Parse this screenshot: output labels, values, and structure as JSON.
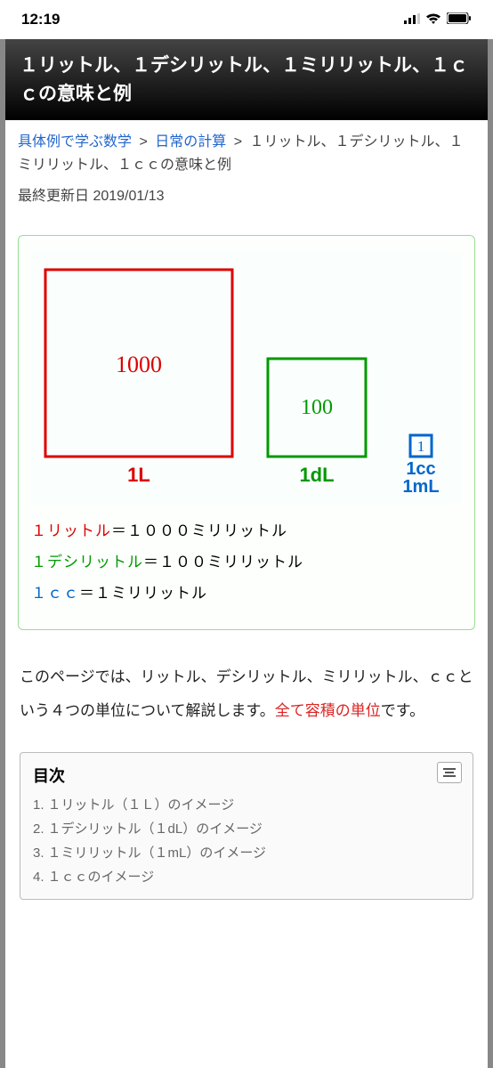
{
  "statusBar": {
    "time": "12:19"
  },
  "pageTitle": "１リットル、１デシリットル、１ミリリットル、１ｃｃの意味と例",
  "breadcrumb": {
    "link1": "具体例で学ぶ数学",
    "link2": "日常の計算",
    "current": "１リットル、１デシリットル、１ミリリットル、１ｃｃの意味と例",
    "sep": ">"
  },
  "lastUpdated": "最終更新日 2019/01/13",
  "diagram": {
    "liter": {
      "value": "1000",
      "label": "1L",
      "color": "#d00"
    },
    "deciliter": {
      "value": "100",
      "label": "1dL",
      "color": "#090"
    },
    "cc": {
      "value": "1",
      "label1": "1cc",
      "label2": "1mL",
      "color": "#06c"
    }
  },
  "conversions": {
    "liter": {
      "key": "１リットル",
      "rest": "＝１０００ミリリットル"
    },
    "deciliter": {
      "key": "１デシリットル",
      "rest": "＝１００ミリリットル"
    },
    "cc": {
      "key": "１ｃｃ",
      "rest": "＝１ミリリットル"
    }
  },
  "bodyText": {
    "part1": "このページでは、リットル、デシリットル、ミリリットル、ｃｃという４つの単位について解説します。",
    "highlight": "全て容積の単位",
    "part2": "です。"
  },
  "toc": {
    "title": "目次",
    "items": [
      {
        "num": "1.",
        "text": "１リットル（１Ｌ）のイメージ"
      },
      {
        "num": "2.",
        "text": "１デシリットル（１dL）のイメージ"
      },
      {
        "num": "3.",
        "text": "１ミリリットル（１mL）のイメージ"
      },
      {
        "num": "4.",
        "text": "１ｃｃのイメージ"
      }
    ]
  }
}
